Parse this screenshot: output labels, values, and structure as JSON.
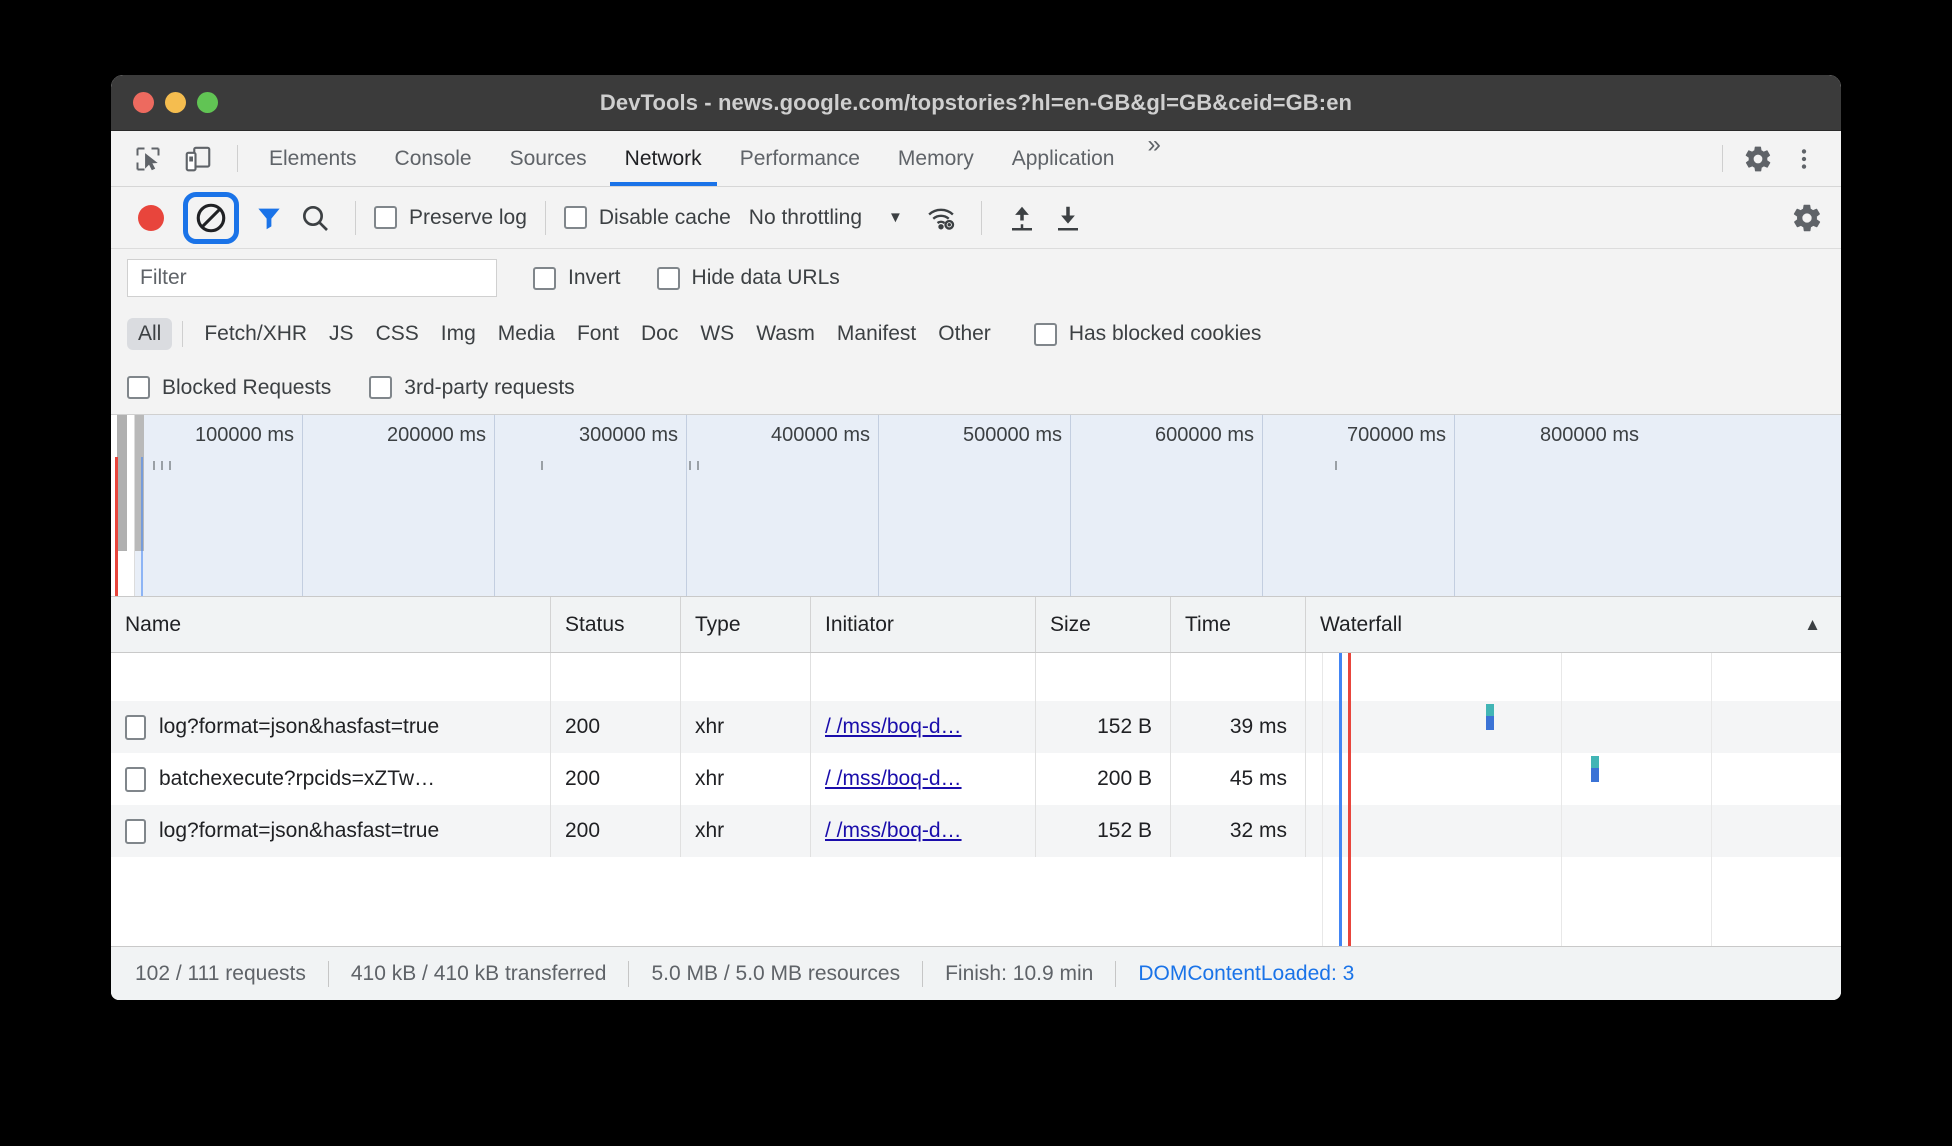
{
  "window": {
    "title": "DevTools - news.google.com/topstories?hl=en-GB&gl=GB&ceid=GB:en",
    "traffic_lights": [
      "close",
      "minimize",
      "maximize"
    ]
  },
  "tabbar": {
    "inspect_icon": "inspect-cursor-icon",
    "device_icon": "device-toolbar-icon",
    "tabs": [
      {
        "label": "Elements",
        "active": false
      },
      {
        "label": "Console",
        "active": false
      },
      {
        "label": "Sources",
        "active": false
      },
      {
        "label": "Network",
        "active": true
      },
      {
        "label": "Performance",
        "active": false
      },
      {
        "label": "Memory",
        "active": false
      },
      {
        "label": "Application",
        "active": false
      }
    ],
    "overflow_label": "»",
    "settings_icon": "gear-icon",
    "menu_icon": "kebab-menu-icon"
  },
  "net_toolbar": {
    "record_label": "record-button",
    "clear_label": "clear-button",
    "clear_focused": true,
    "filter_icon": "funnel-icon",
    "search_icon": "search-icon",
    "preserve_log": {
      "label": "Preserve log",
      "checked": false
    },
    "disable_cache": {
      "label": "Disable cache",
      "checked": false
    },
    "throttling": {
      "value": "No throttling",
      "caret": "▼"
    },
    "wifi_icon": "wifi-settings-icon",
    "import_icon": "upload-har-icon",
    "export_icon": "download-har-icon",
    "settings_icon": "network-settings-gear-icon"
  },
  "filter_row": {
    "filter_placeholder": "Filter",
    "filter_value": "",
    "invert": {
      "label": "Invert",
      "checked": false
    },
    "hide_data_urls": {
      "label": "Hide data URLs",
      "checked": false
    }
  },
  "type_row": {
    "types": [
      {
        "label": "All",
        "active": true
      },
      {
        "label": "Fetch/XHR",
        "active": false
      },
      {
        "label": "JS",
        "active": false
      },
      {
        "label": "CSS",
        "active": false
      },
      {
        "label": "Img",
        "active": false
      },
      {
        "label": "Media",
        "active": false
      },
      {
        "label": "Font",
        "active": false
      },
      {
        "label": "Doc",
        "active": false
      },
      {
        "label": "WS",
        "active": false
      },
      {
        "label": "Wasm",
        "active": false
      },
      {
        "label": "Manifest",
        "active": false
      },
      {
        "label": "Other",
        "active": false
      }
    ],
    "has_blocked_cookies": {
      "label": "Has blocked cookies",
      "checked": false
    }
  },
  "blocked_row": {
    "blocked_requests": {
      "label": "Blocked Requests",
      "checked": false
    },
    "third_party_requests": {
      "label": "3rd-party requests",
      "checked": false
    }
  },
  "overview": {
    "ticks": [
      "100000 ms",
      "200000 ms",
      "300000 ms",
      "400000 ms",
      "500000 ms",
      "600000 ms",
      "700000 ms",
      "800000 ms"
    ]
  },
  "table": {
    "columns": [
      "Name",
      "Status",
      "Type",
      "Initiator",
      "Size",
      "Time",
      "Waterfall"
    ],
    "sort_arrow": "▲",
    "rows": [
      {
        "name": "log?format=json&hasfast=true",
        "status": "200",
        "type": "xhr",
        "initiator": "/  /mss/boq-d…",
        "size": "152 B",
        "time": "39 ms"
      },
      {
        "name": "batchexecute?rpcids=xZTw…",
        "status": "200",
        "type": "xhr",
        "initiator": "/  /mss/boq-d…",
        "size": "200 B",
        "time": "45 ms"
      },
      {
        "name": "log?format=json&hasfast=true",
        "status": "200",
        "type": "xhr",
        "initiator": "/  /mss/boq-d…",
        "size": "152 B",
        "time": "32 ms"
      }
    ]
  },
  "statusbar": {
    "requests": "102 / 111 requests",
    "transferred": "410 kB / 410 kB transferred",
    "resources": "5.0 MB / 5.0 MB resources",
    "finish": "Finish: 10.9 min",
    "dom_content_loaded": "DOMContentLoaded: 3"
  },
  "colors": {
    "accent_blue": "#1a73e8",
    "record_red": "#e8453c",
    "link_blue": "#1a0dab",
    "titlebar": "#3b3b3b",
    "toolbar_bg": "#f3f3f3",
    "overview_bg": "#e8eef7"
  }
}
